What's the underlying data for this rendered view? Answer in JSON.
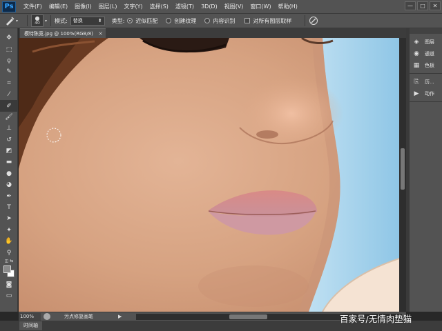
{
  "app": {
    "logo": "Ps",
    "menu": [
      "文件(F)",
      "编辑(E)",
      "图像(I)",
      "图层(L)",
      "文字(Y)",
      "选择(S)",
      "滤镜(T)",
      "3D(D)",
      "视图(V)",
      "窗口(W)",
      "帮助(H)"
    ],
    "window_controls": [
      "—",
      "□",
      "✕"
    ]
  },
  "options": {
    "brush_size": "40",
    "mode_label": "模式:",
    "mode_value": "替换",
    "type_label": "类型:",
    "type_options": [
      "近似匹配",
      "创建纹理",
      "内容识别"
    ],
    "type_selected": "近似匹配",
    "sample_all_label": "对所有图层取样"
  },
  "document": {
    "tab_title": "模特陈竞.jpg @ 100%(RGB/8)",
    "close": "×"
  },
  "status": {
    "zoom": "100%",
    "tool_name": "污点修复画笔"
  },
  "timeline": {
    "tab_label": "时间轴"
  },
  "panels": {
    "group1": [
      {
        "icon": "layers-icon",
        "label": "图层"
      },
      {
        "icon": "channels-icon",
        "label": "通道"
      },
      {
        "icon": "swatches-icon",
        "label": "色板"
      }
    ],
    "group2": [
      {
        "icon": "history-icon",
        "label": "历..."
      },
      {
        "icon": "actions-icon",
        "label": "动作"
      }
    ]
  },
  "watermark": "百家号/无情肉垫猫",
  "colors": {
    "foreground": "#8a8a8a",
    "background": "#ffffff",
    "ui_dark": "#535353",
    "ps_blue": "#34a3ff"
  }
}
